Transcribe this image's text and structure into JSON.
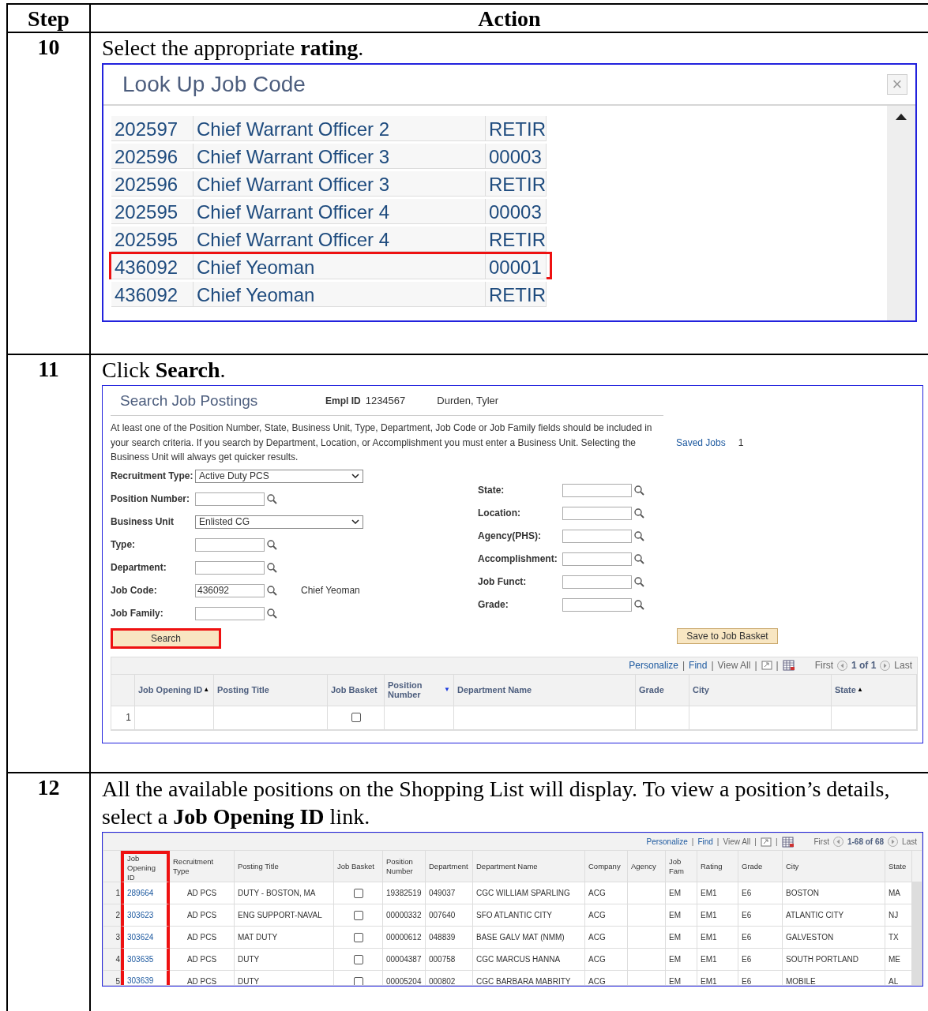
{
  "table": {
    "columns": [
      "Step",
      "Action"
    ]
  },
  "step10": {
    "number": "10",
    "instruction": "Select the appropriate **rating**.",
    "lookup": {
      "title": "Look Up Job Code",
      "close": "×",
      "rows": [
        {
          "code": "202597",
          "description": "Chief Warrant Officer 2",
          "rating": "RETIR",
          "highlighted": false
        },
        {
          "code": "202596",
          "description": "Chief Warrant Officer 3",
          "rating": "00003",
          "highlighted": false
        },
        {
          "code": "202596",
          "description": "Chief Warrant Officer 3",
          "rating": "RETIR",
          "highlighted": false
        },
        {
          "code": "202595",
          "description": "Chief Warrant Officer 4",
          "rating": "00003",
          "highlighted": false
        },
        {
          "code": "202595",
          "description": "Chief Warrant Officer 4",
          "rating": "RETIR",
          "highlighted": false
        },
        {
          "code": "436092",
          "description": "Chief Yeoman",
          "rating": "00001",
          "highlighted": true
        },
        {
          "code": "436092",
          "description": "Chief Yeoman",
          "rating": "RETIR",
          "highlighted": false
        }
      ]
    }
  },
  "step11": {
    "number": "11",
    "instruction": "Click **Search**.",
    "panel": {
      "title": "Search Job Postings",
      "empl_id_label": "Empl ID",
      "empl_id": "1234567",
      "name": "Durden, Tyler",
      "note": "At least one of the Position Number, State, Business Unit, Type, Department, Job Code or Job Family fields should be included in your search criteria. If you search by Department, Location, or Accomplishment you must enter a Business Unit. Selecting the Business Unit will always get quicker results.",
      "saved_jobs_label": "Saved Jobs",
      "saved_jobs_count": "1",
      "left_fields": [
        {
          "kind": "select",
          "label": "Recruitment Type:",
          "value": "Active Duty PCS"
        },
        {
          "kind": "lookup",
          "label": "Position Number:"
        },
        {
          "kind": "select",
          "label": "Business Unit",
          "value": "Enlisted CG"
        },
        {
          "kind": "lookup",
          "label": "Type:"
        },
        {
          "kind": "lookup",
          "label": "Department:"
        },
        {
          "kind": "lookup",
          "label": "Job Code:",
          "value": "436092",
          "description": "Chief Yeoman"
        },
        {
          "kind": "lookup",
          "label": "Job Family:"
        }
      ],
      "right_fields": [
        {
          "kind": "lookup",
          "label": "State:"
        },
        {
          "kind": "lookup",
          "label": "Location:"
        },
        {
          "kind": "lookup",
          "label": "Agency(PHS):"
        },
        {
          "kind": "lookup",
          "label": "Accomplishment:"
        },
        {
          "kind": "lookup",
          "label": "Job Funct:"
        },
        {
          "kind": "lookup",
          "label": "Grade:"
        }
      ],
      "search_button": {
        "label": "Search",
        "highlighted": true
      },
      "basket_button": {
        "label": "Save to Job Basket",
        "highlighted": false
      },
      "grid_nav": {
        "personalize": "Personalize",
        "find": "Find",
        "view_all": "View All",
        "separators": [
          "|",
          "|",
          "|",
          "|"
        ],
        "first": "First",
        "range": "1 of 1",
        "last": "Last"
      },
      "grid_columns": [
        {
          "label": "Job Opening ID",
          "sort": "▲"
        },
        {
          "label": "Posting Title"
        },
        {
          "label": "Job Basket"
        },
        {
          "label": "Position Number",
          "sort": "▼"
        },
        {
          "label": "Department Name"
        },
        {
          "label": "Grade"
        },
        {
          "label": "City"
        },
        {
          "label": "State",
          "sort": "▲"
        }
      ],
      "grid_rows": [
        {
          "number": "1",
          "checked": false
        }
      ]
    }
  },
  "step12": {
    "number": "12",
    "instruction": "All the available positions on the Shopping List will display. To view a position’s details, select a **Job Opening ID** link.",
    "grid_nav": {
      "personalize": "Personalize",
      "find": "Find",
      "view_all": "View All",
      "separators": [
        "|",
        "|",
        "|",
        "|"
      ],
      "first": "First",
      "range": "1-68 of 68",
      "last": "Last"
    },
    "columns": [
      {
        "label": "Job Opening ID",
        "highlighted": true
      },
      {
        "label": "Recruitment Type",
        "highlighted": false
      },
      {
        "label": "Posting Title",
        "highlighted": false
      },
      {
        "label": "Job Basket",
        "highlighted": false
      },
      {
        "label": "Position Number",
        "highlighted": false
      },
      {
        "label": "Department",
        "highlighted": false
      },
      {
        "label": "Department Name",
        "highlighted": false
      },
      {
        "label": "Company",
        "highlighted": false
      },
      {
        "label": "Agency",
        "highlighted": false
      },
      {
        "label": "Job Fam",
        "highlighted": false
      },
      {
        "label": "Rating",
        "highlighted": false
      },
      {
        "label": "Grade",
        "highlighted": false
      },
      {
        "label": "City",
        "highlighted": false
      },
      {
        "label": "State",
        "highlighted": false
      }
    ],
    "rows": [
      {
        "number": "1",
        "cells": [
          "289664",
          "AD PCS",
          "DUTY - BOSTON, MA",
          "",
          "19382519",
          "049037",
          "CGC  WILLIAM SPARLING",
          "ACG",
          "",
          "EM",
          "EM1",
          "E6",
          "BOSTON",
          "MA"
        ],
        "checked": false
      },
      {
        "number": "2",
        "cells": [
          "303623",
          "AD PCS",
          "ENG SUPPORT-NAVAL",
          "",
          "00000332",
          "007640",
          "SFO ATLANTIC CITY",
          "ACG",
          "",
          "EM",
          "EM1",
          "E6",
          "ATLANTIC CITY",
          "NJ"
        ],
        "checked": false
      },
      {
        "number": "3",
        "cells": [
          "303624",
          "AD PCS",
          "MAT DUTY",
          "",
          "00000612",
          "048839",
          "BASE GALV MAT (NMM)",
          "ACG",
          "",
          "EM",
          "EM1",
          "E6",
          "GALVESTON",
          "TX"
        ],
        "checked": false
      },
      {
        "number": "4",
        "cells": [
          "303635",
          "AD PCS",
          "DUTY",
          "",
          "00004387",
          "000758",
          "CGC MARCUS HANNA",
          "ACG",
          "",
          "EM",
          "EM1",
          "E6",
          "SOUTH PORTLAND",
          "ME"
        ],
        "checked": false
      },
      {
        "number": "5",
        "cells": [
          "303639",
          "AD PCS",
          "DUTY",
          "",
          "00005204",
          "000802",
          "CGC BARBARA MABRITY",
          "ACG",
          "",
          "EM",
          "EM1",
          "E6",
          "MOBILE",
          "AL"
        ],
        "checked": false
      }
    ]
  }
}
